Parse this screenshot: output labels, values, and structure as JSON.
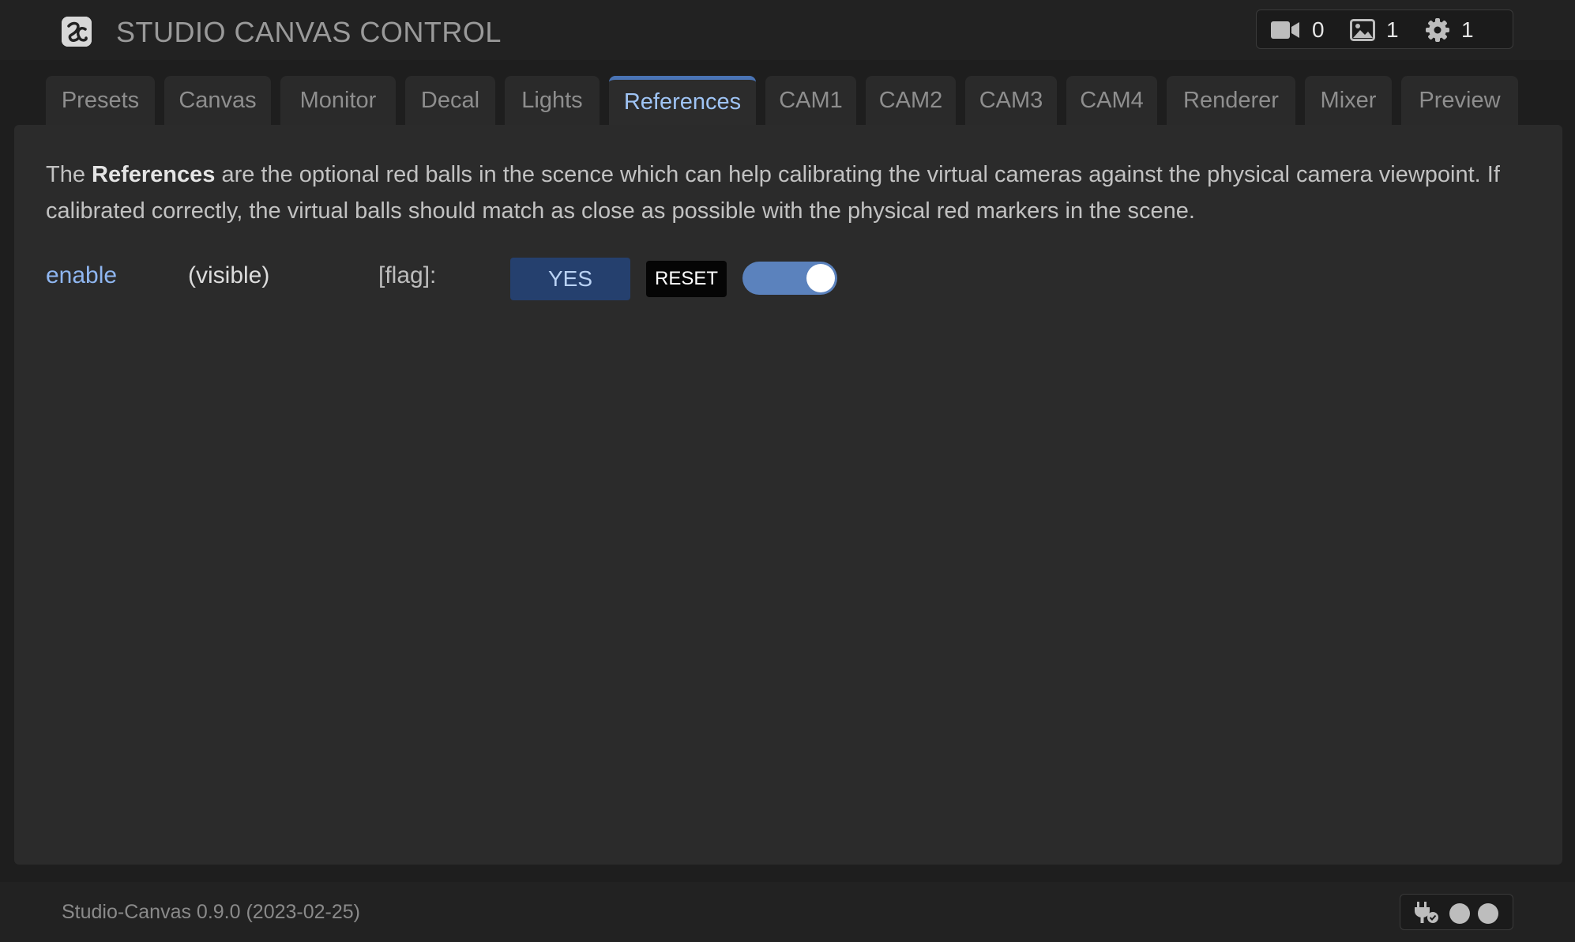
{
  "header": {
    "title": "STUDIO CANVAS CONTROL",
    "logo_icon": "studio-canvas-logo",
    "stats": [
      {
        "icon": "video-camera-icon",
        "value": "0"
      },
      {
        "icon": "image-icon",
        "value": "1"
      },
      {
        "icon": "gear-icon",
        "value": "1"
      }
    ]
  },
  "tabs": [
    {
      "label": "Presets",
      "active": false
    },
    {
      "label": "Canvas",
      "active": false
    },
    {
      "label": "Monitor",
      "active": false
    },
    {
      "label": "Decal",
      "active": false
    },
    {
      "label": "Lights",
      "active": false
    },
    {
      "label": "References",
      "active": true
    },
    {
      "label": "CAM1",
      "active": false
    },
    {
      "label": "CAM2",
      "active": false
    },
    {
      "label": "CAM3",
      "active": false
    },
    {
      "label": "CAM4",
      "active": false
    },
    {
      "label": "Renderer",
      "active": false
    },
    {
      "label": "Mixer",
      "active": false
    },
    {
      "label": "Preview",
      "active": false
    }
  ],
  "panel": {
    "description": {
      "prefix": "The ",
      "emphasis": "References",
      "suffix": " are the optional red balls in the scence which can help calibrating the virtual cameras against the physical camera viewpoint. If calibrated correctly, the virtual balls should match as close as possible with the physical red markers in the scene."
    },
    "parameter": {
      "name": "enable",
      "note": "(visible)",
      "type": "[flag]:",
      "value_label": "YES",
      "reset_label": "RESET",
      "toggle_on": true
    }
  },
  "footer": {
    "version": "Studio-Canvas 0.9.0 (2023-02-25)",
    "status_icon": "plug-connected-icon"
  },
  "colors": {
    "accent": "#4a74b5",
    "active_tab_text": "#9fc4f5",
    "yes_button": "#25406e",
    "toggle": "#5b82bd"
  }
}
